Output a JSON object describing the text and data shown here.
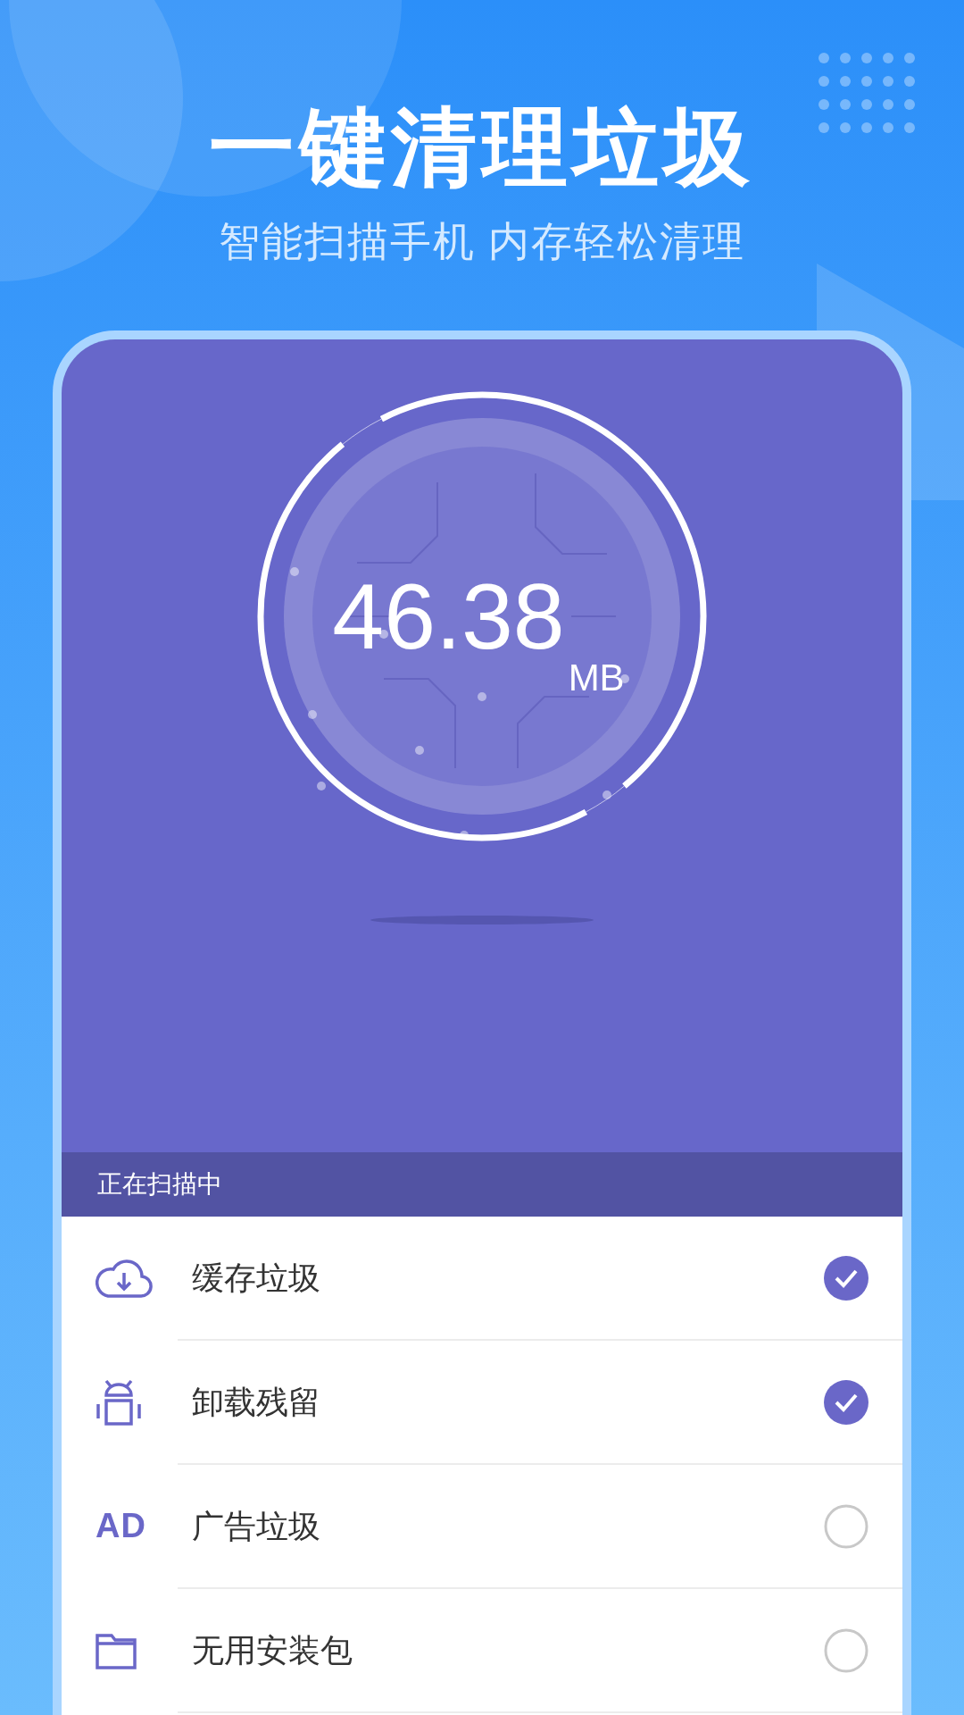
{
  "headline": "一键清理垃圾",
  "subtitle": "智能扫描手机 内存轻松清理",
  "scan": {
    "amount": "46.38",
    "unit": "MB"
  },
  "status_bar": "正在扫描中",
  "items": [
    {
      "kind": "cloud",
      "label": "缓存垃圾",
      "checked": true
    },
    {
      "kind": "android",
      "label": "卸载残留",
      "checked": true
    },
    {
      "kind": "text",
      "icon_text": "AD",
      "label": "广告垃圾",
      "checked": false
    },
    {
      "kind": "folder",
      "label": "无用安装包",
      "checked": false
    }
  ]
}
